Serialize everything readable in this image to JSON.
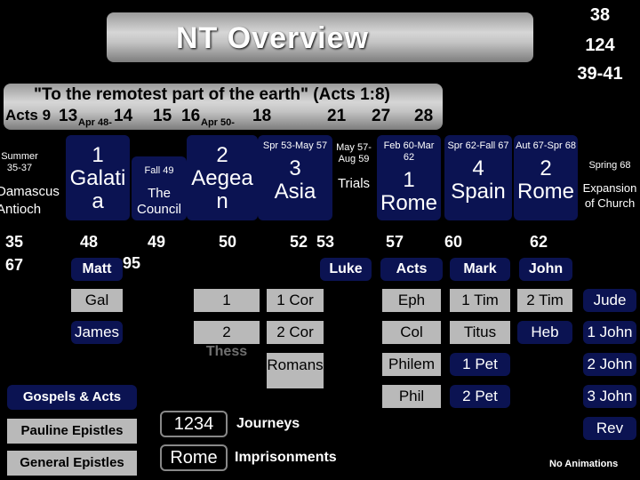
{
  "header": {
    "title": "NT Overview",
    "counts": [
      "38",
      "124",
      "39-41"
    ]
  },
  "subtitle": "\"To the remotest part of the earth\" (Acts 1:8)",
  "acts_ref_row": {
    "prefix": "Acts 9",
    "items": [
      "13",
      "Apr 48-",
      "14",
      "15",
      "16",
      "Apr 50-",
      "18",
      "21",
      "27",
      "28"
    ]
  },
  "timeline": {
    "summer": "Summer 35-37",
    "damascus": "Damascus Antioch",
    "j1_num": "1",
    "j1_place": "Galatia",
    "fall49": "Fall 49",
    "council": "The Council",
    "j2_num": "2",
    "j2_place": "Aegean",
    "spr53": "Spr 53-May 57",
    "j3_num": "3",
    "j3_place": "Asia",
    "may57": "May 57-Aug 59",
    "trials": "Trials",
    "feb60": "Feb 60-Mar 62",
    "r1_num": "1",
    "r1_place": "Rome",
    "spr62": "Spr 62-Fall 67",
    "spain_num": "4",
    "spain_place": "Spain",
    "aut67": "Aut 67-Spr 68",
    "r2_num": "2",
    "r2_place": "Rome",
    "spring68": "Spring 68",
    "expansion": "Expansion of Church"
  },
  "years": [
    "35",
    "67",
    "48",
    "49",
    "50",
    "52",
    "53",
    "57",
    "60",
    "62",
    "95"
  ],
  "books": {
    "matt": "Matt",
    "luke": "Luke",
    "acts": "Acts",
    "mark": "Mark",
    "john": "John",
    "gal": "Gal",
    "james": "James",
    "thess1": "1",
    "thess2": "2",
    "thess_label": "Thess",
    "cor1": "1 Cor",
    "cor2": "2 Cor",
    "romans": "Romans",
    "eph": "Eph",
    "col": "Col",
    "philem": "Philem",
    "phil": "Phil",
    "tim1": "1 Tim",
    "titus": "Titus",
    "pet1": "1 Pet",
    "pet2": "2 Pet",
    "tim2": "2 Tim",
    "heb": "Heb",
    "jude": "Jude",
    "john1": "1 John",
    "john2": "2 John",
    "john3": "3 John",
    "rev": "Rev"
  },
  "legend": {
    "gospels": "Gospels & Acts",
    "pauline": "Pauline Epistles",
    "general": "General Epistles",
    "journeys_key": "1234",
    "journeys": "Journeys",
    "rome_key": "Rome",
    "imprisonment": "Imprisonments"
  },
  "footer": "No Animations"
}
